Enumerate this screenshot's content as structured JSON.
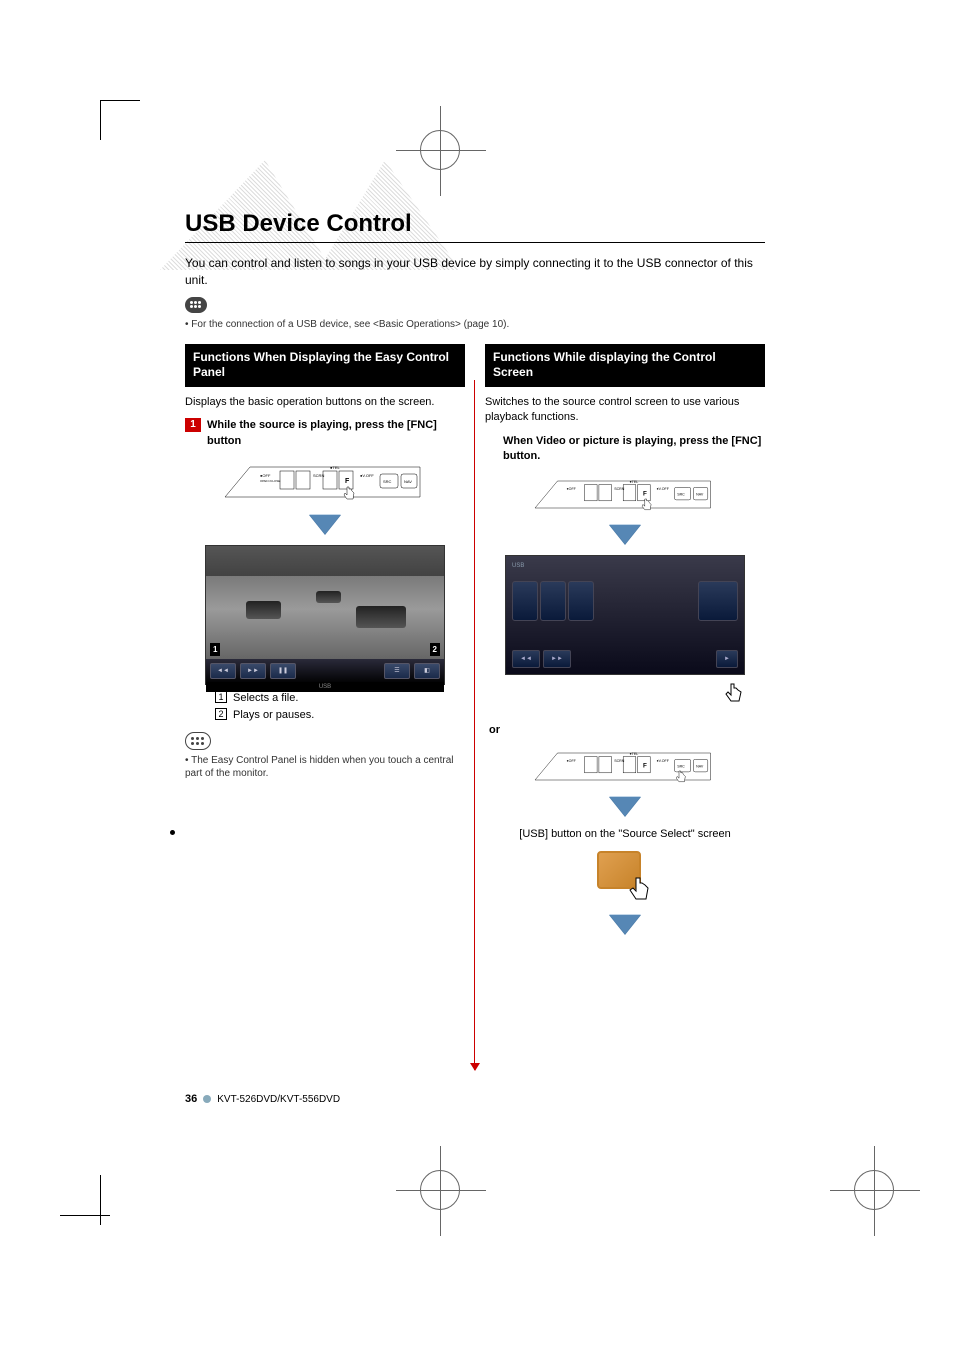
{
  "title": "USB Device Control",
  "intro": "You can control and listen to songs in your USB device by simply connecting it to the USB connector of this unit.",
  "note1": "• For the connection of a USB device, see <Basic Operations> (page 10).",
  "left": {
    "header": "Functions When Displaying the Easy Control Panel",
    "body1": "Displays the basic operation buttons on the screen.",
    "step1_num": "1",
    "step1_text": "While the source is playing, press the [FNC] button",
    "device_labels": {
      "off": "●OFF",
      "open": "OPEN /CLOSE",
      "scrn": "SCRN",
      "tel": "●TEL",
      "voff": "●V.OFF",
      "src": "SRC",
      "nav": "NAV"
    },
    "legend1_num": "1",
    "legend1_text": "Selects a file.",
    "legend2_num": "2",
    "legend2_text": "Plays or pauses.",
    "note2": "• The Easy Control Panel is hidden when you touch a central part of the monitor.",
    "callout1": "1",
    "callout2": "2"
  },
  "right": {
    "header": "Functions While displaying the Control Screen",
    "body1": "Switches to the source control screen to use various playback functions.",
    "step_text": "When Video or picture is playing, press the [FNC] button.",
    "or": "or",
    "caption": "[USB] button on the \"Source Select\" screen"
  },
  "footer": {
    "page": "36",
    "model": "KVT-526DVD/KVT-556DVD"
  }
}
